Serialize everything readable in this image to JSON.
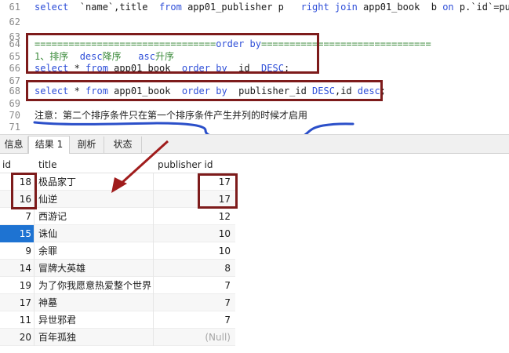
{
  "editor": {
    "lines": [
      {
        "num": "61",
        "parts": [
          [
            "kw",
            "select"
          ],
          [
            "tx",
            "  `name`,title  "
          ],
          [
            "kw",
            "from"
          ],
          [
            "tx",
            " app01_publisher p   "
          ],
          [
            "kw",
            "right join"
          ],
          [
            "tx",
            " app01_book  b "
          ],
          [
            "kw",
            "on"
          ],
          [
            "tx",
            " p.`id`=publi"
          ]
        ]
      },
      {
        "num": "62",
        "parts": []
      },
      {
        "num": "63",
        "parts": []
      },
      {
        "num": "64",
        "parts": [
          [
            "cm",
            "================================"
          ],
          [
            "kw",
            "order by"
          ],
          [
            "cm",
            "=============================="
          ]
        ]
      },
      {
        "num": "65",
        "parts": [
          [
            "cm",
            "1、排序  "
          ],
          [
            "kw",
            "desc"
          ],
          [
            "cm",
            "降序   "
          ],
          [
            "kw",
            "asc"
          ],
          [
            "cm",
            "升序"
          ]
        ]
      },
      {
        "num": "66",
        "parts": [
          [
            "kw",
            "select"
          ],
          [
            "tx",
            " * "
          ],
          [
            "kw",
            "from"
          ],
          [
            "tx",
            " app01_book  "
          ],
          [
            "kw",
            "order by"
          ],
          [
            "tx",
            "  id  "
          ],
          [
            "kw",
            "DESC"
          ],
          [
            "tx",
            ";"
          ]
        ]
      },
      {
        "num": "67",
        "parts": []
      },
      {
        "num": "68",
        "parts": [
          [
            "kw",
            "select"
          ],
          [
            "tx",
            " * "
          ],
          [
            "kw",
            "from"
          ],
          [
            "tx",
            " app01_book  "
          ],
          [
            "kw",
            "order by"
          ],
          [
            "tx",
            "  publisher_id "
          ],
          [
            "kw",
            "DESC"
          ],
          [
            "tx",
            ","
          ],
          [
            "tx",
            "id "
          ],
          [
            "kw",
            "desc"
          ],
          [
            "tx",
            ";"
          ]
        ]
      },
      {
        "num": "69",
        "parts": []
      },
      {
        "num": "70",
        "parts": [
          [
            "nt",
            "注意：第二个排序条件只在第一个排序条件产生并列的时候才启用"
          ]
        ]
      },
      {
        "num": "71",
        "parts": []
      }
    ]
  },
  "tabs": [
    {
      "label": "信息",
      "active": false
    },
    {
      "label": "结果 1",
      "active": true
    },
    {
      "label": "剖析",
      "active": false
    },
    {
      "label": "状态",
      "active": false
    }
  ],
  "grid": {
    "columns": [
      "id",
      "title",
      "publisher id"
    ],
    "rows": [
      {
        "id": "18",
        "title": "极品家丁",
        "publisher_id": "17"
      },
      {
        "id": "16",
        "title": "仙逆",
        "publisher_id": "17"
      },
      {
        "id": "7",
        "title": "西游记",
        "publisher_id": "12"
      },
      {
        "id": "15",
        "title": "诛仙",
        "publisher_id": "10",
        "selected": true
      },
      {
        "id": "9",
        "title": "余罪",
        "publisher_id": "10"
      },
      {
        "id": "14",
        "title": "冒牌大英雄",
        "publisher_id": "8"
      },
      {
        "id": "19",
        "title": "为了你我愿意热爱整个世界",
        "publisher_id": "7"
      },
      {
        "id": "17",
        "title": "神墓",
        "publisher_id": "7"
      },
      {
        "id": "11",
        "title": "异世邪君",
        "publisher_id": "7"
      },
      {
        "id": "20",
        "title": "百年孤独",
        "publisher_id": "(Null)",
        "null": true
      }
    ]
  },
  "colors": {
    "keyword": "#2f4fd8",
    "comment": "#3b8a3b",
    "annotation_box": "#7d1b1b",
    "annotation_arrow": "#a01c1c",
    "underline": "#2b4fc9",
    "selection": "#1e73d2"
  }
}
